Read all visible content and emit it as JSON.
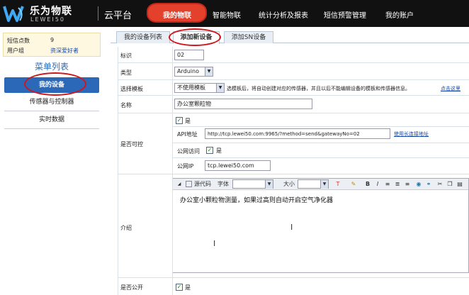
{
  "header": {
    "brand_cn": "乐为物联",
    "brand_en": "LEWEI50",
    "platform": "云平台",
    "nav": [
      "我的物联",
      "智能物联",
      "统计分析及报表",
      "短信预警管理",
      "我的账户"
    ]
  },
  "account": {
    "sms_label": "短信点数",
    "sms_value": "9",
    "group_label": "用户组",
    "group_value": "资深爱好者"
  },
  "sidebar": {
    "title": "菜单列表",
    "items": [
      "我的设备",
      "传感器与控制器",
      "实时数据"
    ]
  },
  "tabs": [
    "我的设备列表",
    "添加新设备",
    "添加SN设备"
  ],
  "form": {
    "id_label": "标识",
    "id_value": "02",
    "type_label": "类型",
    "type_value": "Arduino",
    "template_label": "选择模板",
    "template_value": "不使用模板",
    "template_hint": "选模板后，将自动创建对应的传感器，并且以后不能编辑设备的模板和传感器信息。",
    "template_link": "点击这里",
    "name_label": "名称",
    "name_value": "办公室颗粒物",
    "control_label": "是否可控",
    "control_check": "是",
    "api_label": "API地址",
    "api_value": "http://tcp.lewei50.com:9965/?method=send&gatewayNo=02",
    "api_link": "使用长连接地址",
    "public_access_label": "公网访问",
    "public_access_check": "是",
    "public_ip_label": "公网IP",
    "public_ip_value": "tcp.lewei50.com",
    "intro_label": "介绍",
    "intro_text": "办公室小颗粒物测量，如果过高则自动开启空气净化器",
    "public_label": "是否公开",
    "public_check": "是"
  },
  "editor": {
    "source_label": "源代码",
    "font_label": "字体",
    "size_label": "大小"
  },
  "colors": {
    "header_bg": "#111111",
    "accent_red": "#e3412b",
    "sidebar_active": "#2c68b8",
    "annotation_red": "#d0161b"
  }
}
